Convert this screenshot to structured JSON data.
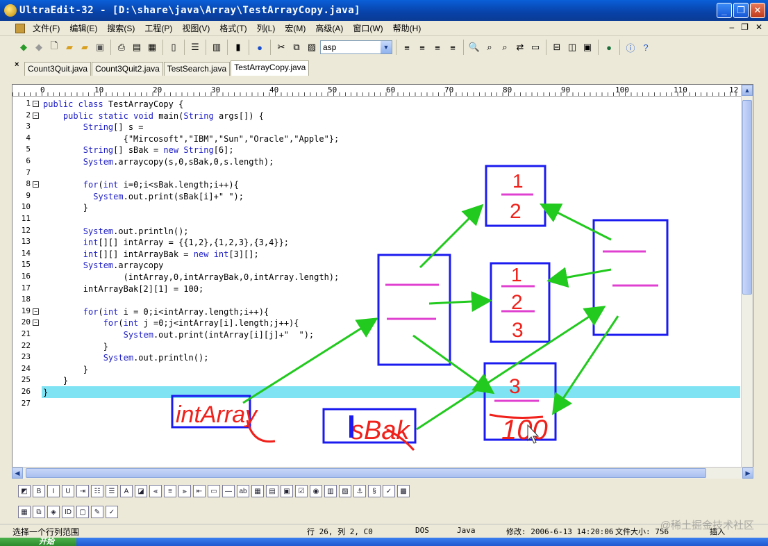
{
  "window": {
    "title": "UltraEdit-32 - [D:\\share\\java\\Array\\TestArrayCopy.java]"
  },
  "menu": [
    "文件(F)",
    "编辑(E)",
    "搜索(S)",
    "工程(P)",
    "视图(V)",
    "格式(T)",
    "列(L)",
    "宏(M)",
    "高级(A)",
    "窗口(W)",
    "帮助(H)"
  ],
  "toolbar": {
    "syntax_value": "asp"
  },
  "tabs": [
    "Count3Quit.java",
    "Count3Quit2.java",
    "TestSearch.java",
    "TestArrayCopy.java"
  ],
  "active_tab": "TestArrayCopy.java",
  "ruler": [
    "0",
    "10",
    "20",
    "30",
    "40",
    "50",
    "60",
    "70",
    "80",
    "90",
    "100",
    "110",
    "12"
  ],
  "code": {
    "lines": [
      "public class TestArrayCopy {",
      "    public static void main(String args[]) {",
      "        String[] s =",
      "                {\"Mircosoft\",\"IBM\",\"Sun\",\"Oracle\",\"Apple\"};",
      "        String[] sBak = new String[6];",
      "        System.arraycopy(s,0,sBak,0,s.length);",
      "",
      "        for(int i=0;i<sBak.length;i++){",
      "          System.out.print(sBak[i]+\" \");",
      "        }",
      "",
      "        System.out.println();",
      "        int[][] intArray = {{1,2},{1,2,3},{3,4}};",
      "        int[][] intArrayBak = new int[3][];",
      "        System.arraycopy",
      "                (intArray,0,intArrayBak,0,intArray.length);",
      "        intArrayBak[2][1] = 100;",
      "",
      "        for(int i = 0;i<intArray.length;i++){",
      "            for(int j =0;j<intArray[i].length;j++){",
      "                System.out.print(intArray[i][j]+\"  \");",
      "            }",
      "            System.out.println();",
      "        }",
      "    }",
      "}",
      ""
    ],
    "fold_lines": [
      1,
      2,
      8,
      19,
      20
    ],
    "current_line": 26
  },
  "annotations": {
    "labels": [
      "intArray",
      "sBak"
    ],
    "cells": [
      "1",
      "2",
      "1",
      "2",
      "3",
      "3",
      "100"
    ]
  },
  "status": {
    "hint": "选择一个行列范围",
    "position": "行 26, 列 2, C0",
    "line_ending": "DOS",
    "language": "Java",
    "modified": "修改: 2006-6-13 14:20:06",
    "file_size": "文件大小: 756",
    "insert_mode": "插入"
  },
  "watermark": "@稀土掘金技术社区",
  "taskbar": {
    "start_label": "开始"
  },
  "colors": {
    "annotation_blue": "#1b1bf0",
    "annotation_red": "#f0201a",
    "annotation_green": "#22c91e",
    "annotation_magenta": "#e040d0",
    "current_line": "#7fe3f4"
  }
}
